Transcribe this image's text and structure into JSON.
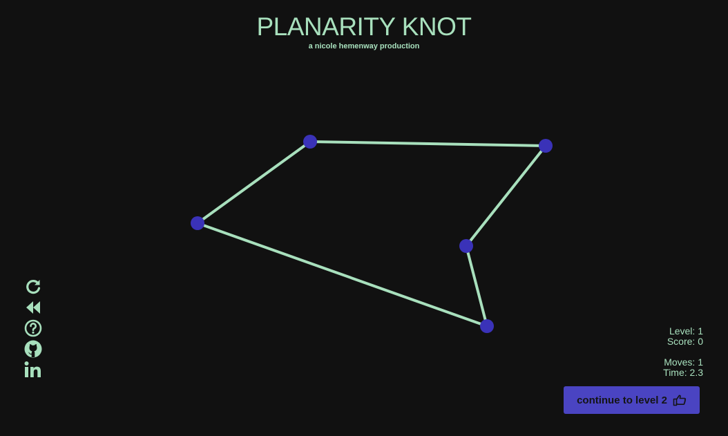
{
  "header": {
    "title": "PLANARITY KNOT",
    "subtitle": "a nicole hemenway production"
  },
  "colors": {
    "background": "#111111",
    "accent": "#a8e0bd",
    "node": "#3a32b8",
    "button": "#4a44c2"
  },
  "graph": {
    "nodes": [
      {
        "id": "n1"
      },
      {
        "id": "n2"
      },
      {
        "id": "n3"
      },
      {
        "id": "n4"
      },
      {
        "id": "n5"
      }
    ],
    "edges": [
      [
        "n1",
        "n2"
      ],
      [
        "n2",
        "n3"
      ],
      [
        "n3",
        "n4"
      ],
      [
        "n4",
        "n5"
      ],
      [
        "n5",
        "n1"
      ]
    ]
  },
  "sidebar": {
    "icons": [
      "restart-icon",
      "rewind-icon",
      "help-icon",
      "github-icon",
      "linkedin-icon"
    ]
  },
  "stats": {
    "level_label": "Level:",
    "level": "1",
    "score_label": "Score:",
    "score": "0",
    "moves_label": "Moves:",
    "moves": "1",
    "time_label": "Time:",
    "time": "2.3"
  },
  "continue_button": {
    "label": "continue to level 2",
    "icon": "pointing-hand-icon"
  }
}
